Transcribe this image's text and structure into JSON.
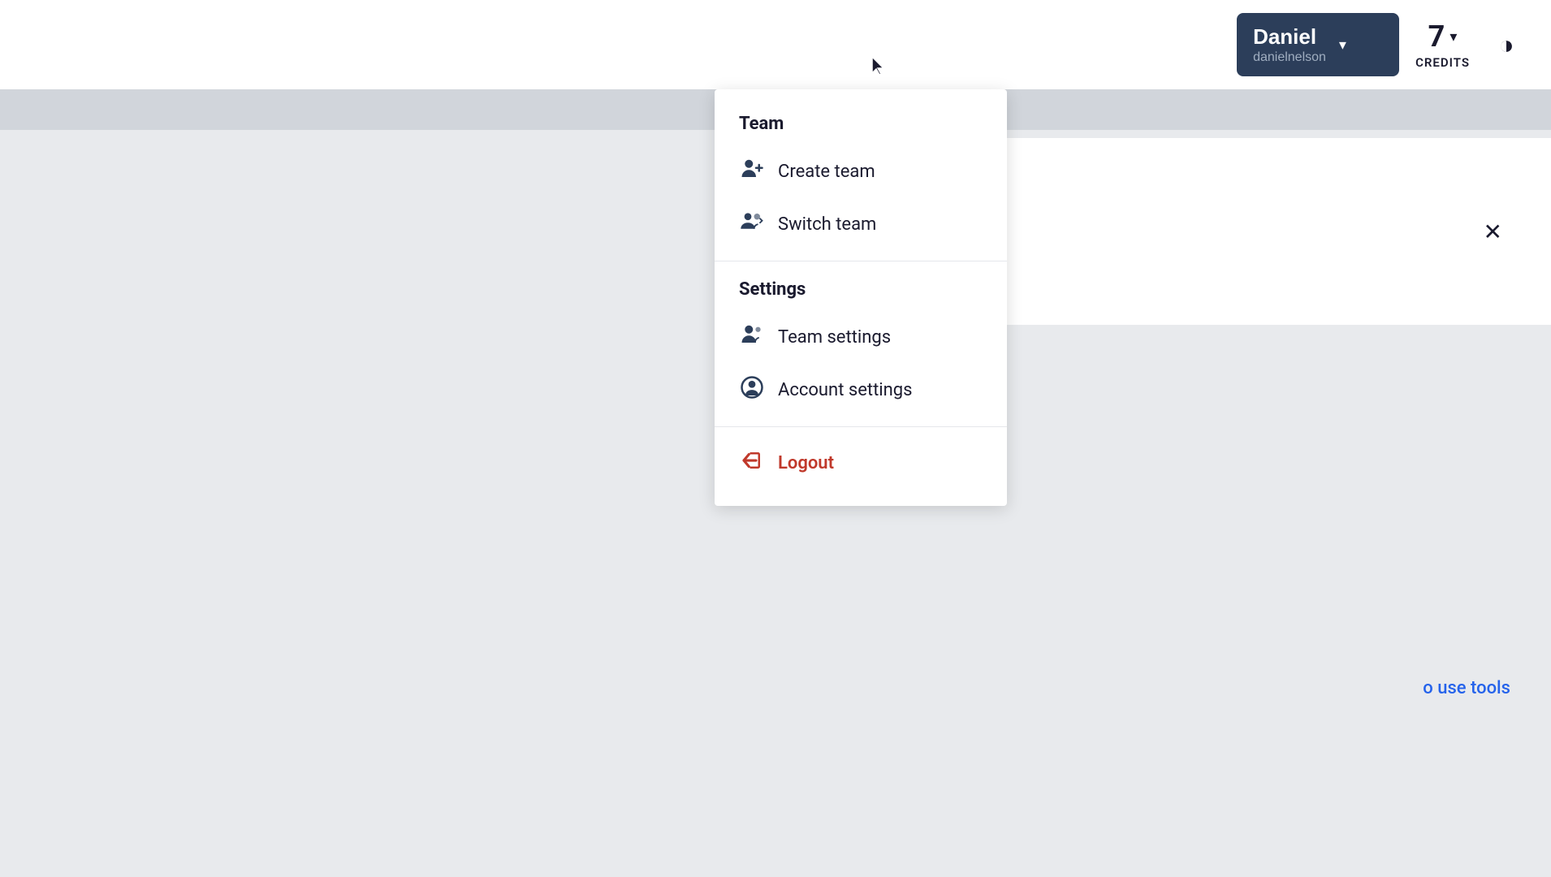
{
  "navbar": {
    "user": {
      "name": "Daniel",
      "username": "danielnelson"
    },
    "credits": {
      "count": "7",
      "label": "CREDITS"
    },
    "buttons": {
      "chevron": "▾",
      "theme_toggle": "◑"
    }
  },
  "dropdown": {
    "team_section_title": "Team",
    "settings_section_title": "Settings",
    "items": [
      {
        "id": "create-team",
        "label": "Create team",
        "icon": "create-team-icon"
      },
      {
        "id": "switch-team",
        "label": "Switch team",
        "icon": "switch-team-icon"
      },
      {
        "id": "team-settings",
        "label": "Team settings",
        "icon": "team-settings-icon"
      },
      {
        "id": "account-settings",
        "label": "Account settings",
        "icon": "account-settings-icon"
      },
      {
        "id": "logout",
        "label": "Logout",
        "icon": "logout-icon"
      }
    ]
  },
  "content": {
    "tools_link_text": "o use tools"
  }
}
